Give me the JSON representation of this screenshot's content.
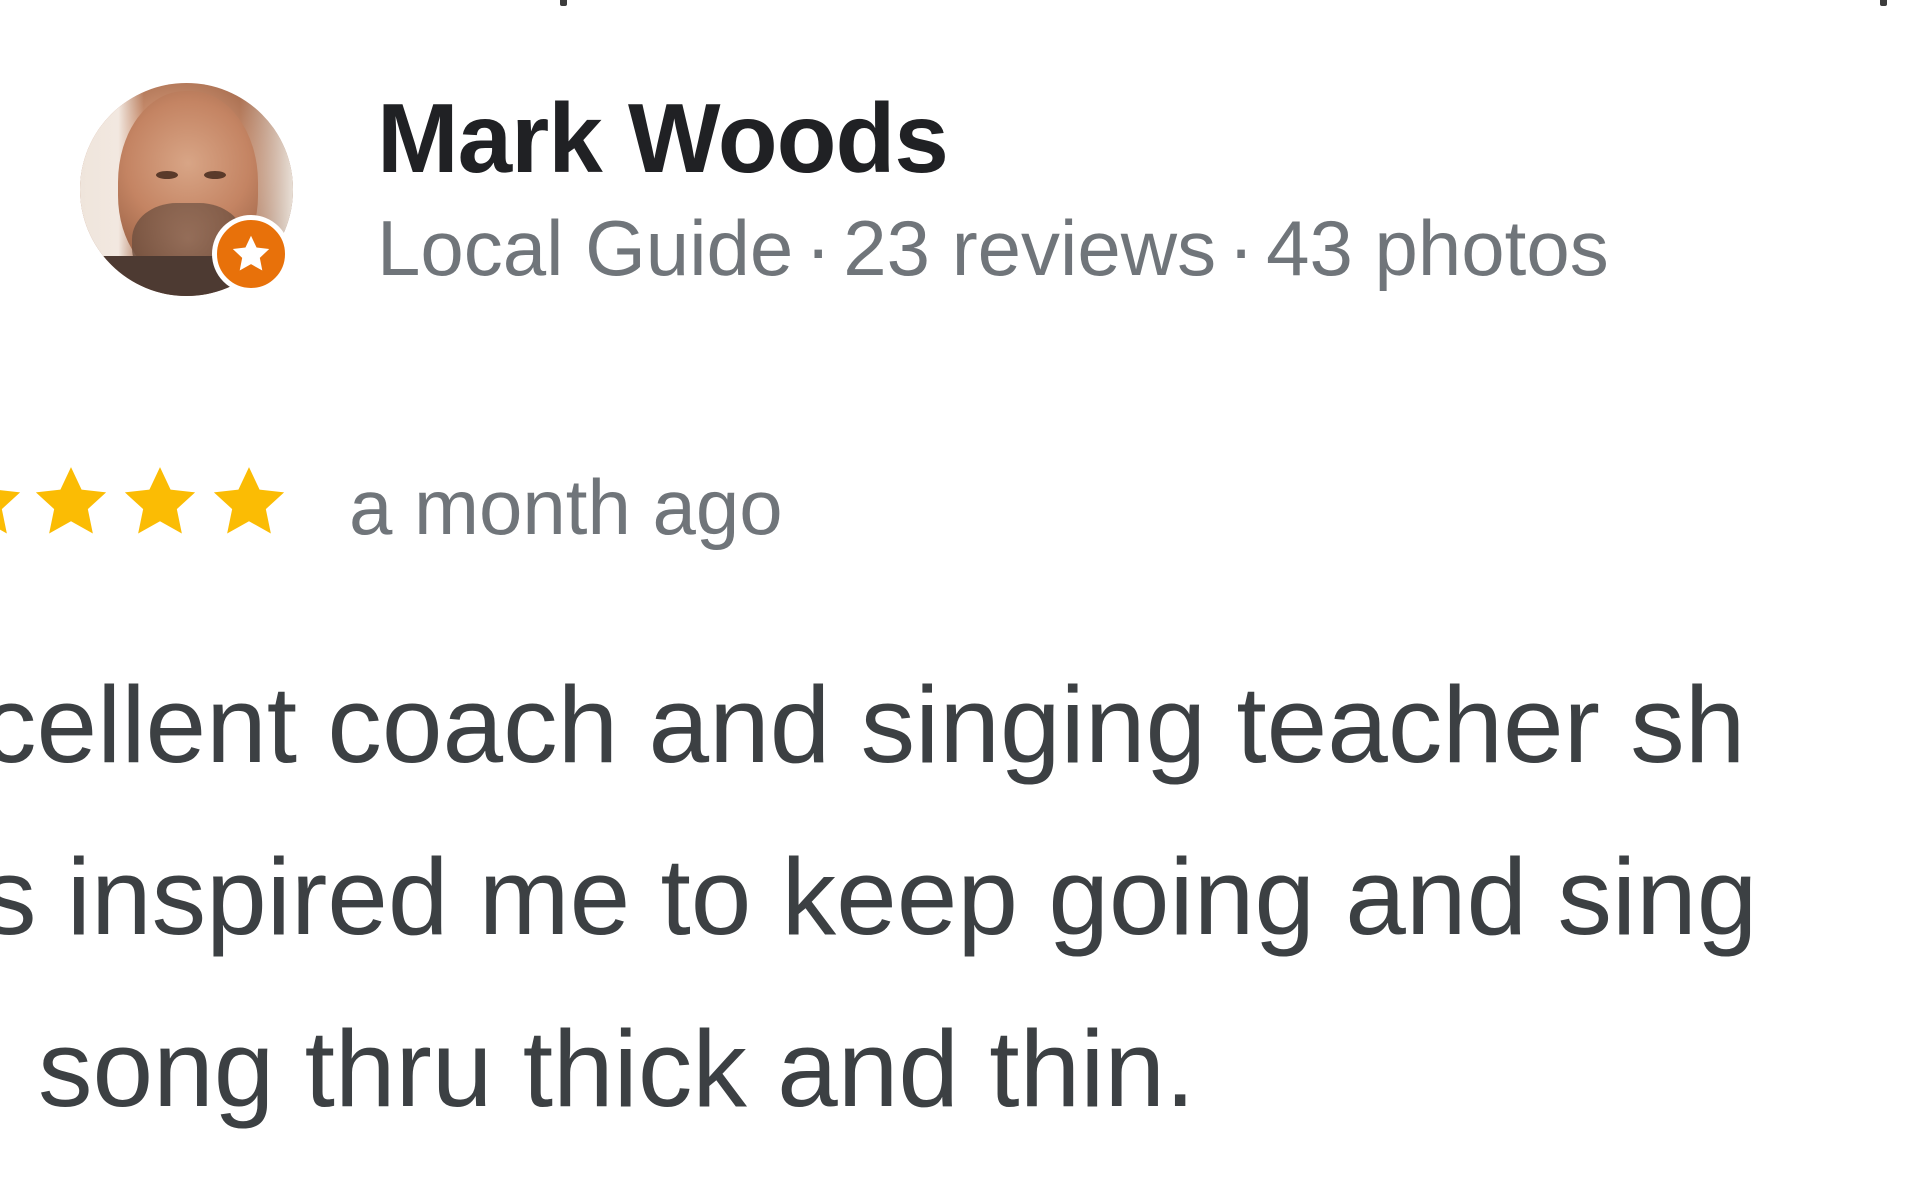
{
  "reviewer": {
    "name": "Mark Woods",
    "badge": "Local Guide",
    "separator": "·",
    "reviews": "23 reviews",
    "photos": "43 photos"
  },
  "review": {
    "rating": 5,
    "time": "a month ago",
    "text_lines": [
      "cellent coach and singing teacher sh",
      "s inspired me to keep going and sing",
      "song thru thick and thin."
    ]
  },
  "colors": {
    "star": "#fbbc04",
    "badge": "#e8710a",
    "name": "#202124",
    "secondary_text": "#70757a",
    "body_text": "#3c4043"
  },
  "icons": {
    "avatar": "profile-photo",
    "badge": "local-guide-star-icon",
    "rating": "star-icon"
  }
}
